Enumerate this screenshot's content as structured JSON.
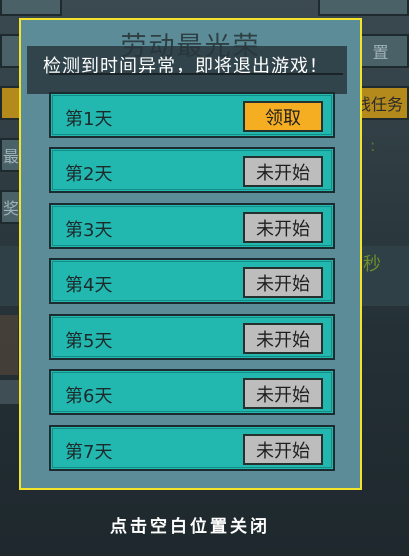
{
  "modal": {
    "title": "劳动最光荣",
    "toast": "检测到时间异常，即将退出游戏！",
    "days": [
      {
        "label": "第1天",
        "button": "领取",
        "state": "claimable"
      },
      {
        "label": "第2天",
        "button": "未开始",
        "state": "locked"
      },
      {
        "label": "第3天",
        "button": "未开始",
        "state": "locked"
      },
      {
        "label": "第4天",
        "button": "未开始",
        "state": "locked"
      },
      {
        "label": "第5天",
        "button": "未开始",
        "state": "locked"
      },
      {
        "label": "第6天",
        "button": "未开始",
        "state": "locked"
      },
      {
        "label": "第7天",
        "button": "未开始",
        "state": "locked"
      }
    ]
  },
  "close_hint": "点击空白位置关闭",
  "background": {
    "right_buttons": [
      "置",
      "线任务"
    ],
    "left_buttons": [
      "最",
      "奖"
    ],
    "green_text": "秒"
  },
  "colors": {
    "modal_border": "#f3e32a",
    "modal_bg": "#5c8c98",
    "row_bg": "#22b8b0",
    "claim_button": "#f5ae22",
    "locked_button": "#bdbdbd"
  }
}
